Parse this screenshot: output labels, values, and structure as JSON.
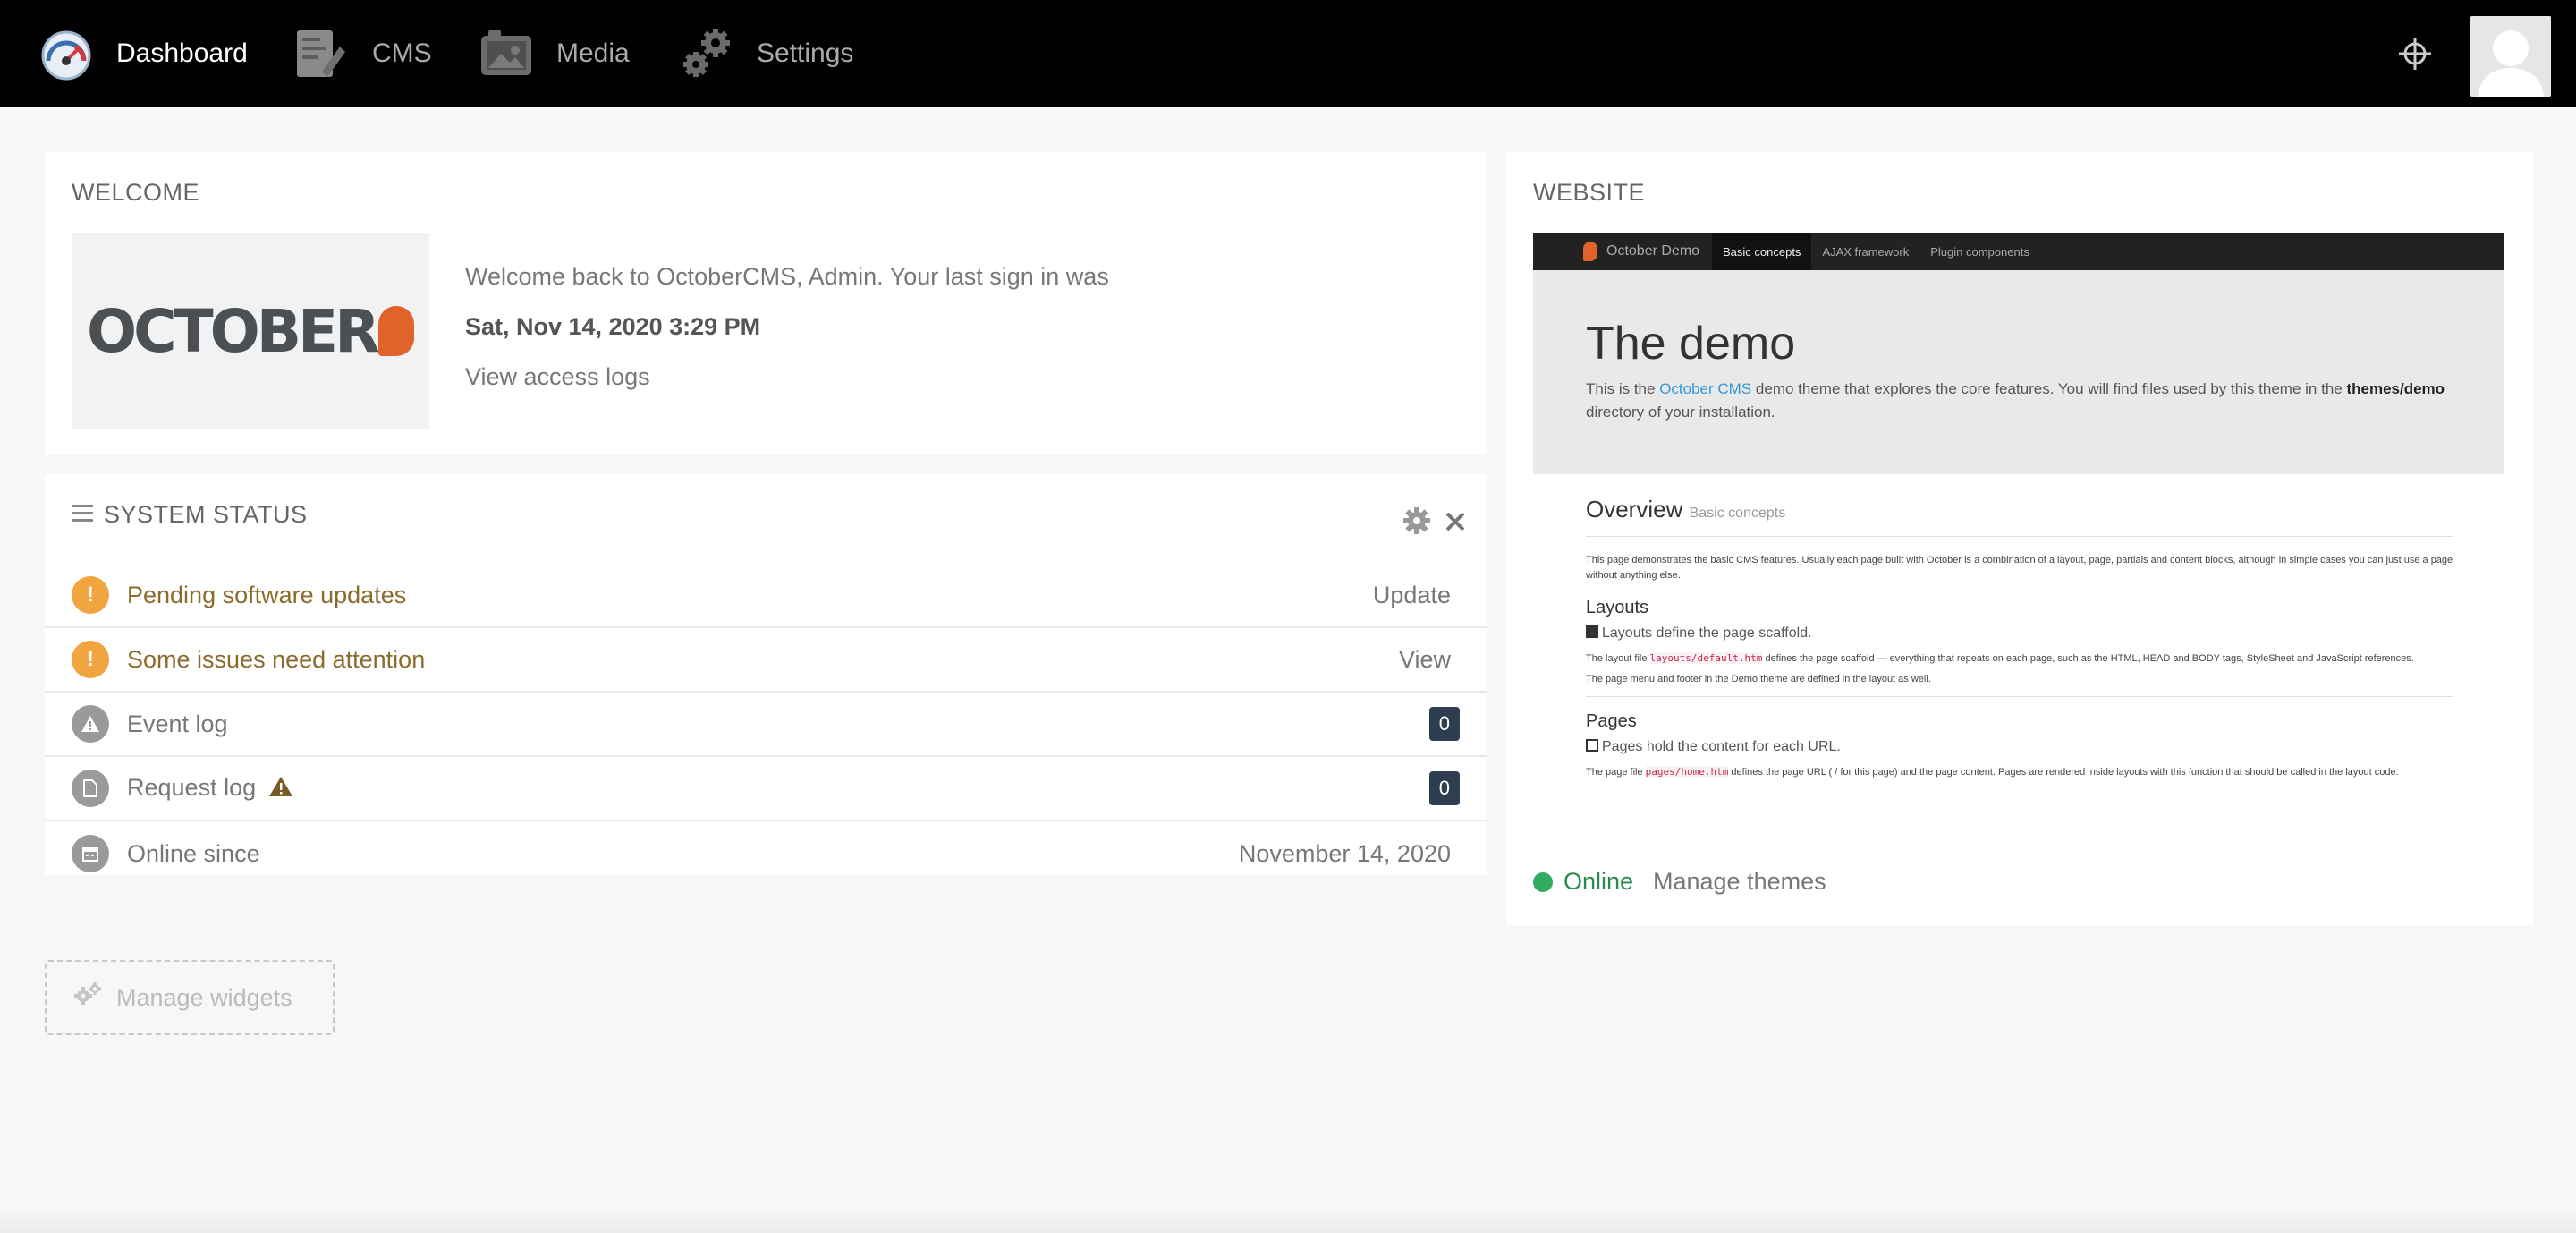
{
  "nav": {
    "items": [
      {
        "label": "Dashboard",
        "icon": "dashboard-gauge-icon"
      },
      {
        "label": "CMS",
        "icon": "cms-pages-icon"
      },
      {
        "label": "Media",
        "icon": "media-camera-icon"
      },
      {
        "label": "Settings",
        "icon": "settings-gears-icon"
      }
    ],
    "active": "Dashboard"
  },
  "welcome": {
    "title": "Welcome",
    "logo_text": "OCTOBER",
    "message": "Welcome back to OctoberCMS, Admin. Your last sign in was",
    "last_sign_in": "Sat, Nov 14, 2020 3:29 PM",
    "access_logs_link": "View access logs"
  },
  "system_status": {
    "title": "System status",
    "rows": [
      {
        "label": "Pending software updates",
        "action": "Update",
        "icon": "exclamation-icon"
      },
      {
        "label": "Some issues need attention",
        "action": "View",
        "icon": "exclamation-icon"
      },
      {
        "label": "Event log",
        "count": "0",
        "icon": "warning-icon"
      },
      {
        "label": "Request log",
        "count": "0",
        "icon": "file-icon"
      },
      {
        "label": "Online since",
        "value": "November 14, 2020",
        "icon": "calendar-icon"
      }
    ]
  },
  "manage_widgets": "Manage widgets",
  "website": {
    "title": "Website",
    "preview": {
      "brand": "October Demo",
      "menu": [
        "Basic concepts",
        "AJAX framework",
        "Plugin components"
      ],
      "heading": "The demo",
      "lead_prefix": "This is the ",
      "lead_link": "October CMS",
      "lead_mid": " demo theme that explores the core features. You will find files used by this theme in the ",
      "lead_bold": "themes/demo",
      "lead_suffix": " directory of your installation.",
      "overview": "Overview",
      "overview_sub": "Basic concepts",
      "overview_text": "This page demonstrates the basic CMS features. Usually each page built with October is a combination of a layout, page, partials and content blocks, although in simple cases you can just use a page without anything else.",
      "layouts_title": "Layouts",
      "layouts_sub": "Layouts define the page scaffold.",
      "layouts_text_1a": "The layout file ",
      "layouts_code": "layouts/default.htm",
      "layouts_text_1b": " defines the page scaffold — everything that repeats on each page, such as the HTML, HEAD and BODY tags, StyleSheet and JavaScript references.",
      "layouts_text_2": "The page menu and footer in the Demo theme are defined in the layout as well.",
      "pages_title": "Pages",
      "pages_sub": "Pages hold the content for each URL.",
      "pages_text_a": "The page file ",
      "pages_code": "pages/home.htm",
      "pages_text_b": " defines the page URL ( / for this page) and the page content. Pages are rendered inside layouts with this function that should be called in the layout code:"
    },
    "status": "Online",
    "manage_themes": "Manage themes"
  },
  "colors": {
    "topbar": "#000000",
    "warning": "#f0a53e",
    "online": "#31ac5f",
    "badge": "#2c3e50",
    "accent": "#e0632a"
  }
}
